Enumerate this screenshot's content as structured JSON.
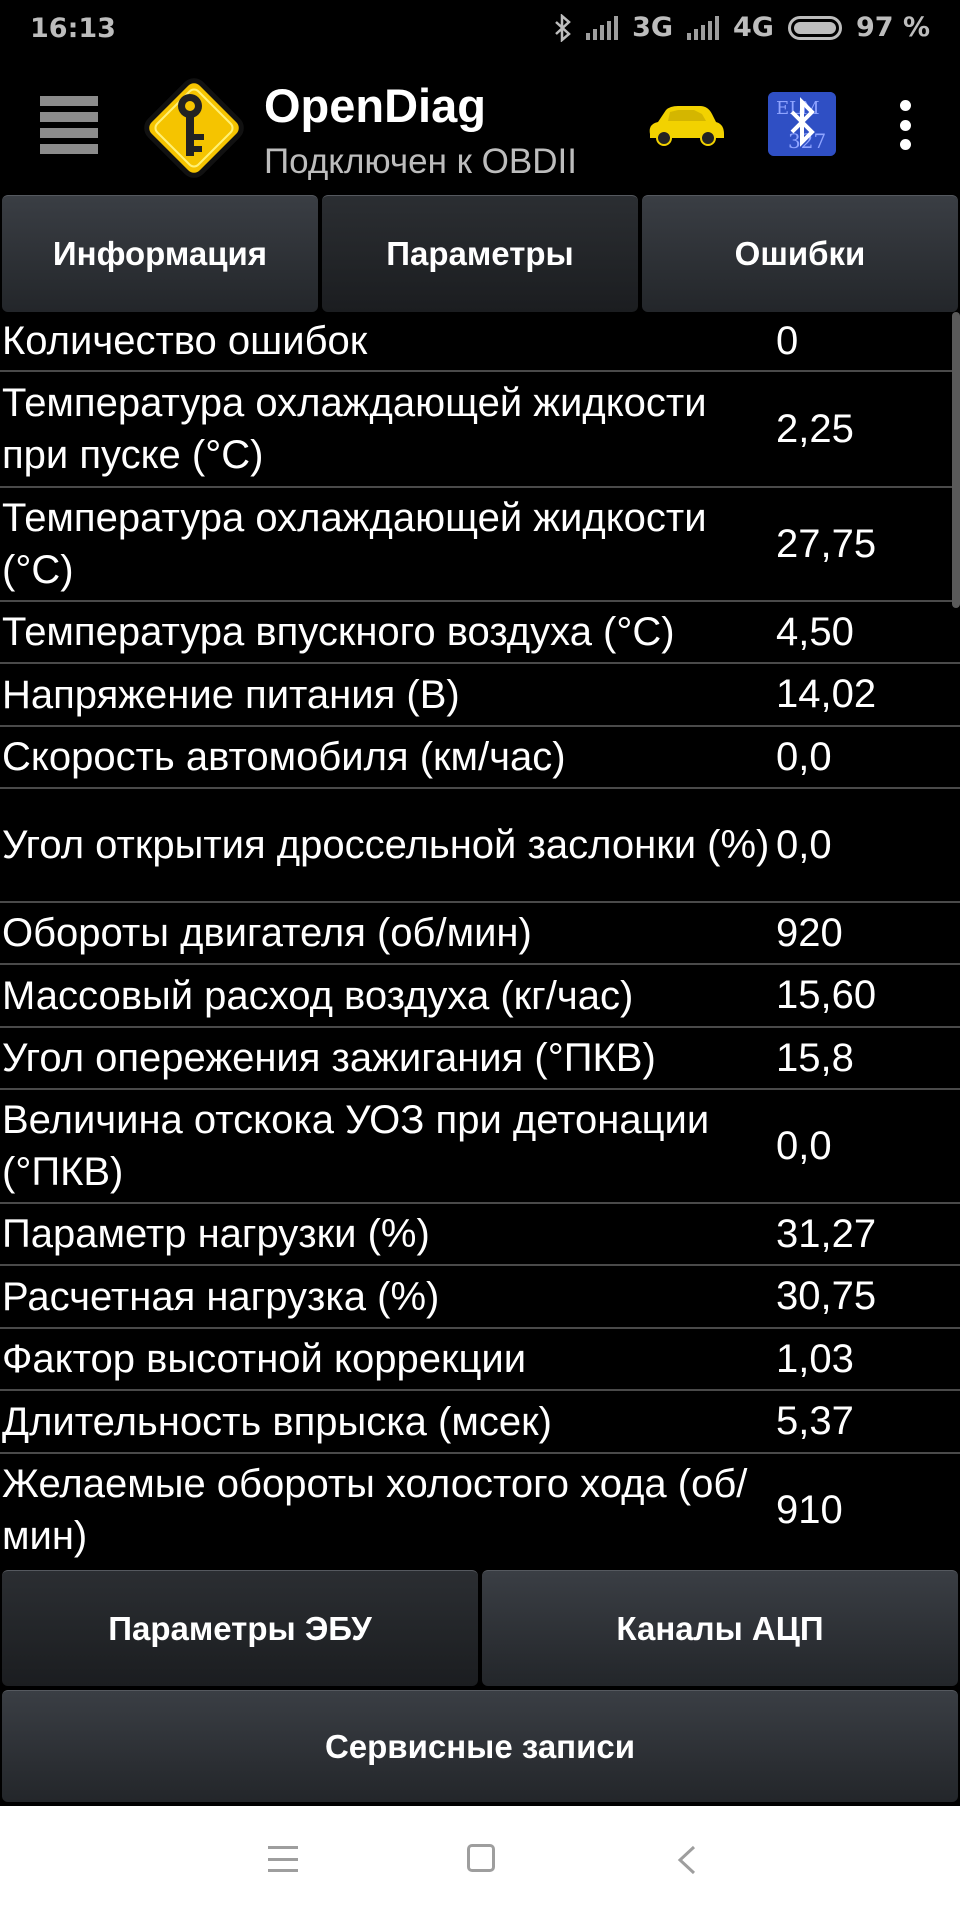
{
  "status_bar": {
    "time": "16:13",
    "network_1": "3G",
    "network_2": "4G",
    "battery_percent": "97 %",
    "icons": [
      "bluetooth-icon",
      "signal-icon",
      "signal-icon",
      "battery-icon"
    ]
  },
  "app_bar": {
    "title": "OpenDiag",
    "subtitle": "Подключен к OBDII",
    "icons": [
      "menu-icon",
      "app-logo",
      "car-icon",
      "bluetooth-elm-icon",
      "overflow-menu-icon"
    ]
  },
  "tabs": [
    {
      "label": "Информация"
    },
    {
      "label": "Параметры",
      "active": true
    },
    {
      "label": "Ошибки"
    }
  ],
  "parameters": [
    {
      "name": "Количество ошибок",
      "value": "0"
    },
    {
      "name": "Температура охлаждающей жидкости при пуске (°C)",
      "value": "2,25"
    },
    {
      "name": "Температура охлаждающей жидкости (°C)",
      "value": "27,75"
    },
    {
      "name": "Температура впускного воздуха (°C)",
      "value": "4,50"
    },
    {
      "name": "Напряжение питания (В)",
      "value": "14,02"
    },
    {
      "name": "Скорость автомобиля (км/час)",
      "value": "0,0"
    },
    {
      "name": "Угол открытия дроссельной заслонки (%)",
      "value": "0,0"
    },
    {
      "name": "Обороты двигателя (об/мин)",
      "value": "920"
    },
    {
      "name": "Массовый расход воздуха (кг/час)",
      "value": "15,60"
    },
    {
      "name": "Угол опережения зажигания (°ПКВ)",
      "value": "15,8"
    },
    {
      "name": "Величина отскока УОЗ при детонации (°ПКВ)",
      "value": "0,0"
    },
    {
      "name": "Параметр нагрузки (%)",
      "value": "31,27"
    },
    {
      "name": "Расчетная нагрузка (%)",
      "value": "30,75"
    },
    {
      "name": "Фактор высотной коррекции",
      "value": "1,03"
    },
    {
      "name": "Длительность впрыска (мсек)",
      "value": "5,37"
    },
    {
      "name": "Желаемые обороты холостого хода (об/мин)",
      "value": "910"
    }
  ],
  "bottom_buttons": {
    "ecu_params": "Параметры ЭБУ",
    "adc_channels": "Каналы АЦП",
    "service_records": "Сервисные записи"
  },
  "colors": {
    "background": "#000000",
    "button_gradient_top": "#3a3e44",
    "button_gradient_bottom": "#23262a",
    "row_divider": "#4a4a4a",
    "logo_yellow": "#f5c400",
    "car_yellow": "#f2d200",
    "bluetooth_blue": "#2f4fc4"
  }
}
